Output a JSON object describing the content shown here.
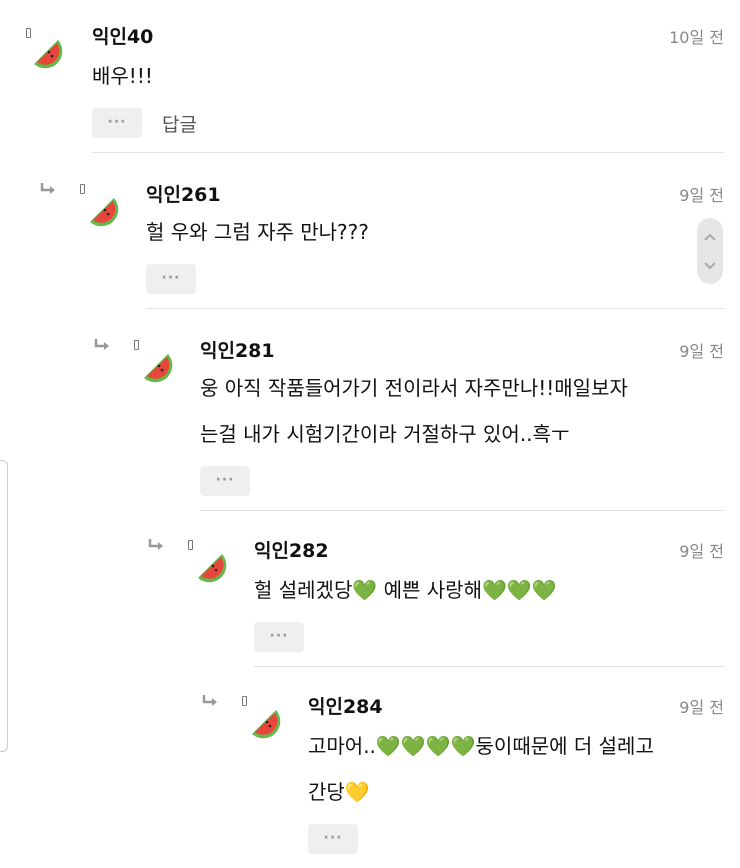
{
  "colors": {
    "text": "#111111",
    "meta": "#888888",
    "button_bg": "#efefef",
    "divider": "#e2e2e2",
    "avatar_rind": "#67b84a",
    "avatar_flesh": "#e8453c"
  },
  "comments": [
    {
      "author": "익인40",
      "time": "10일 전",
      "lines": [
        "배우!!!"
      ],
      "more_label": "···",
      "reply_label": "답글",
      "icon": "watermelon-icon"
    },
    {
      "author": "익인261",
      "time": "9일 전",
      "lines": [
        "헐 우와 그럼 자주 만나???"
      ],
      "more_label": "···",
      "icon": "watermelon-icon"
    },
    {
      "author": "익인281",
      "time": "9일 전",
      "lines": [
        "웅 아직 작품들어가기 전이라서 자주만나!!매일보자",
        "는걸 내가 시험기간이라 거절하구 있어..흑ㅜ"
      ],
      "more_label": "···",
      "icon": "watermelon-icon"
    },
    {
      "author": "익인282",
      "time": "9일 전",
      "lines": [
        "헐 설레겠당💚 예쁜 사랑해💚💚💚"
      ],
      "more_label": "···",
      "icon": "watermelon-icon"
    },
    {
      "author": "익인284",
      "time": "9일 전",
      "lines": [
        "고마어..💚💚💚💚둥이때문에 더 설레고",
        "간당💛"
      ],
      "more_label": "···",
      "icon": "watermelon-icon"
    }
  ]
}
